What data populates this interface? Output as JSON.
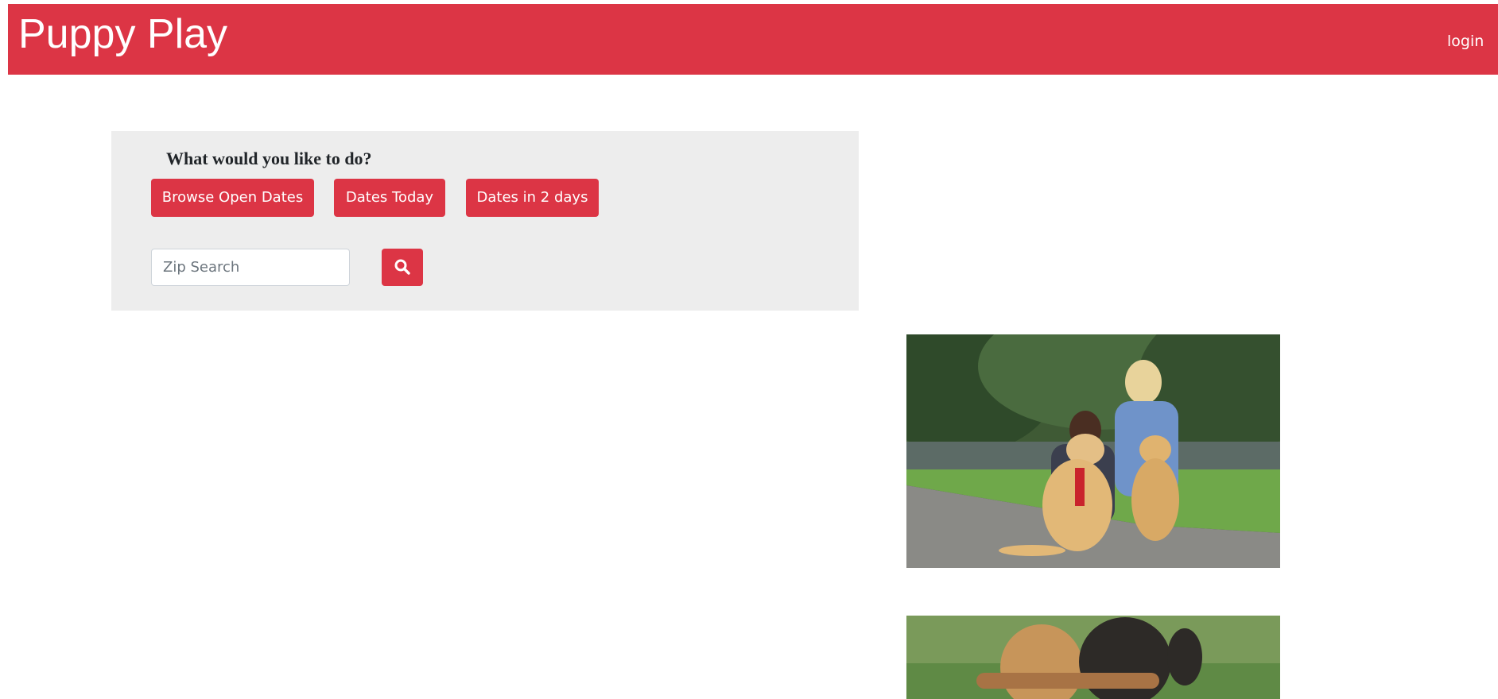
{
  "header": {
    "brand": "Puppy Play",
    "login": "login",
    "background_color": "#dc3545"
  },
  "panel": {
    "title": "What would you like to do?",
    "buttons": [
      {
        "label": "Browse Open Dates"
      },
      {
        "label": "Dates Today"
      },
      {
        "label": "Dates in 2 days"
      }
    ],
    "zip_search": {
      "placeholder": "Zip Search",
      "value": ""
    },
    "search_icon": "search-icon"
  },
  "images": [
    {
      "name": "two-women-with-golden-retrievers-photo"
    },
    {
      "name": "two-dogs-carrying-stick-photo"
    }
  ],
  "colors": {
    "accent": "#dc3545",
    "panel_bg": "#ededed"
  }
}
